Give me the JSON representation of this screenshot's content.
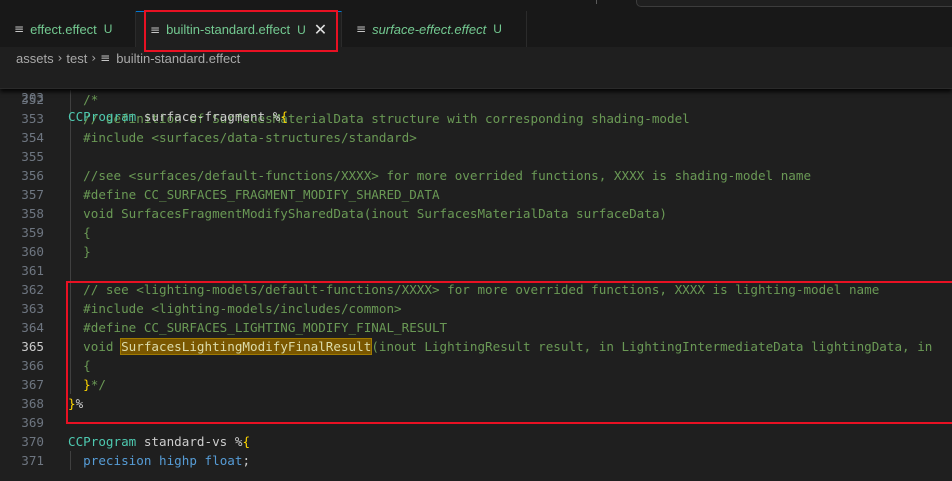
{
  "tabs": [
    {
      "label": "effect.effect",
      "git": "U",
      "italic": false,
      "active": false
    },
    {
      "label": "builtin-standard.effect",
      "git": "U",
      "italic": false,
      "active": true
    },
    {
      "label": "surface-effect.effect",
      "git": "U",
      "italic": true,
      "active": false
    }
  ],
  "breadcrumb": {
    "items": [
      "assets",
      "test",
      "builtin-standard.effect"
    ]
  },
  "sticky": {
    "line": "203",
    "code": "CCProgram surface-fragment %{"
  },
  "editor": {
    "current_line": "365",
    "lines": [
      {
        "n": "352",
        "code": "  /*"
      },
      {
        "n": "353",
        "code": "  // definition of SurfacesMaterialData structure with corresponding shading-model"
      },
      {
        "n": "354",
        "code": "  #include <surfaces/data-structures/standard>"
      },
      {
        "n": "355",
        "code": ""
      },
      {
        "n": "356",
        "code": "  //see <surfaces/default-functions/XXXX> for more overrided functions, XXXX is shading-model name"
      },
      {
        "n": "357",
        "code": "  #define CC_SURFACES_FRAGMENT_MODIFY_SHARED_DATA"
      },
      {
        "n": "358",
        "code": "  void SurfacesFragmentModifySharedData(inout SurfacesMaterialData surfaceData)"
      },
      {
        "n": "359",
        "code": "  {"
      },
      {
        "n": "360",
        "code": "  }"
      },
      {
        "n": "361",
        "code": ""
      },
      {
        "n": "362",
        "code": "  // see <lighting-models/default-functions/XXXX> for more overrided functions, XXXX is lighting-model name"
      },
      {
        "n": "363",
        "code": "  #include <lighting-models/includes/common>"
      },
      {
        "n": "364",
        "code": "  #define CC_SURFACES_LIGHTING_MODIFY_FINAL_RESULT"
      },
      {
        "n": "365",
        "code": "  void SurfacesLightingModifyFinalResult(inout LightingResult result, in LightingIntermediateData lightingData, in"
      },
      {
        "n": "366",
        "code": "  {"
      },
      {
        "n": "367",
        "code": "  }*/"
      },
      {
        "n": "368",
        "code": "}%"
      },
      {
        "n": "369",
        "code": ""
      },
      {
        "n": "370",
        "code": "CCProgram standard-vs %{"
      },
      {
        "n": "371",
        "code": "  precision highp float;"
      }
    ]
  },
  "colors": {
    "comment": "#6a9955",
    "keyword": "#569cd6",
    "type": "#4ec9b0",
    "function": "#dcdcaa",
    "git_untracked": "#73c991",
    "annotation_box": "#e81123",
    "search_highlight": "#7a5700"
  },
  "icons": {
    "file": "file-lines-icon",
    "close": "close-icon",
    "chevron": "chevron-right-icon"
  }
}
